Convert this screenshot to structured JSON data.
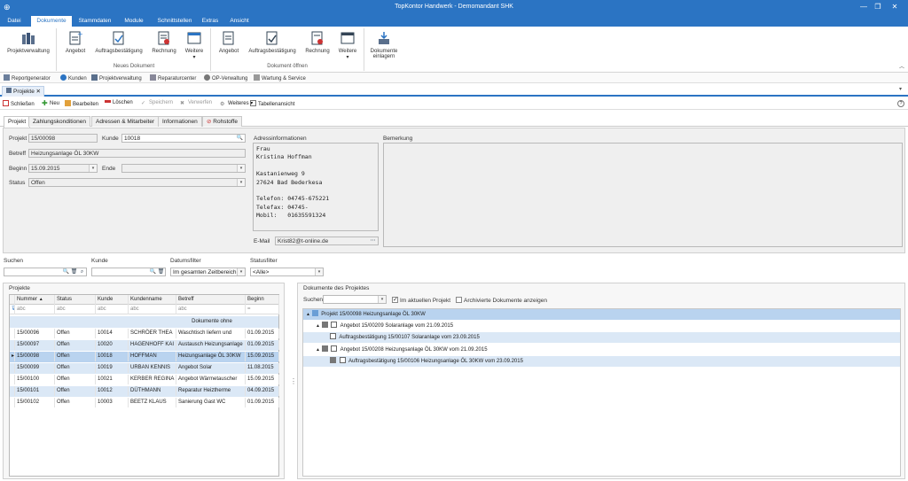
{
  "window": {
    "title": "TopKontor Handwerk - Demomandant SHK"
  },
  "menu_tabs": [
    "Datei",
    "Dokumente",
    "Stammdaten",
    "Module",
    "Schnittstellen",
    "Extras",
    "Ansicht"
  ],
  "ribbon": {
    "projektverwaltung": "Projektverwaltung",
    "neues": {
      "angebot": "Angebot",
      "auftrag": "Auftragsbestätigung",
      "rechnung": "Rechnung",
      "weitere": "Weitere",
      "group": "Neues Dokument"
    },
    "oeffnen": {
      "angebot": "Angebot",
      "auftrag": "Auftragsbestätigung",
      "rechnung": "Rechnung",
      "weitere": "Weitere",
      "group": "Dokument öffnen"
    },
    "einlagern_1": "Dokumente",
    "einlagern_2": "einlagern"
  },
  "quickbar": [
    "Reportgenerator",
    "Kunden",
    "Projektverwaltung",
    "Reparaturcenter",
    "OP-Verwaltung",
    "Wartung & Service"
  ],
  "doc_tab": "Projekte",
  "toolbar": {
    "schliessen": "Schließen",
    "neu": "Neu",
    "bearbeiten": "Bearbeiten",
    "loeschen": "Löschen",
    "speichern": "Speichern",
    "verwerfen": "Verwerfen",
    "weiteres": "Weiteres",
    "tabellenansicht": "Tabellenansicht"
  },
  "project_tabs": [
    "Projekt",
    "Zahlungskonditionen",
    "Adressen & Mitarbeiter",
    "Informationen",
    "Rohstoffe"
  ],
  "form": {
    "projekt_label": "Projekt",
    "projekt": "15/00098",
    "kunde_label": "Kunde",
    "kunde": "10018",
    "betreff_label": "Betreff",
    "betreff": "Heizungsanlage ÖL 30KW",
    "beginn_label": "Beginn",
    "beginn": "15.09.2015",
    "ende_label": "Ende",
    "ende": "",
    "status_label": "Status",
    "status": "Offen",
    "adress_label": "Adressinformationen",
    "adresse": "Frau\nKristina Hoffman\n\nKastanienweg 9\n27624 Bad Bederkesa\n\nTelefon: 04745-675221\nTelefax: 04745-\nMobil:   01635591324",
    "email_label": "E-Mail",
    "email": "Krist82@t-online.de",
    "bemerkung_label": "Bemerkung"
  },
  "filters": {
    "suchen_label": "Suchen",
    "suchen": "",
    "kunde_label": "Kunde",
    "kunde": "",
    "datum_label": "Datumsfilter",
    "datum": "Im gesamten Zeitbereich",
    "status_label": "Statusfilter",
    "status": "<Alle>"
  },
  "projects": {
    "title": "Projekte",
    "columns": [
      "Nummer",
      "Status",
      "Kunde",
      "Kundenname",
      "Betreff",
      "Beginn"
    ],
    "filter_row": [
      "abc",
      "abc",
      "abc",
      "abc",
      "abc",
      "="
    ],
    "group_label": "Dokumente ohne",
    "rows": [
      [
        "15/00096",
        "Offen",
        "10014",
        "SCHRÖER THEA",
        "Waschtisch liefern und",
        "01.09.2015"
      ],
      [
        "15/00097",
        "Offen",
        "10020",
        "HAGENHOFF KAI",
        "Austausch Heizungsanlage",
        "01.09.2015"
      ],
      [
        "15/00098",
        "Offen",
        "10018",
        "HOFFMAN",
        "Heizungsanlage ÖL 30KW",
        "15.09.2015"
      ],
      [
        "15/00099",
        "Offen",
        "10019",
        "URBAN KENNIS",
        "Angebot Solar",
        "11.08.2015"
      ],
      [
        "15/00100",
        "Offen",
        "10021",
        "KERBER REGINA",
        "Angebot Wärmetauscher",
        "15.09.2015"
      ],
      [
        "15/00101",
        "Offen",
        "10012",
        "DÜTHMANN",
        "Reparatur Heiztherme",
        "04.09.2015"
      ],
      [
        "15/00102",
        "Offen",
        "10003",
        "BEETZ KLAUS",
        "Sanierung Gast WC",
        "01.09.2015"
      ]
    ]
  },
  "documents": {
    "title": "Dokumente des Projektes",
    "suchen_label": "Suchen",
    "check_aktuell": "Im aktuellen Projekt",
    "check_archiv": "Archivierte Dokumente anzeigen",
    "tree": [
      "Projekt 15/00098 Heizungsanlage ÖL 30KW",
      "Angebot 15/00209 Solaranlage vom 21.09.2015",
      "Auftragsbestätigung 15/00107 Solaranlage vom 23.09.2015",
      "Angebot 15/00208 Heizungsanlage ÖL 30KW vom 21.09.2015",
      "Auftragsbestätigung 15/00106 Heizungsanlage ÖL 30KW vom 23.09.2015"
    ]
  },
  "colors": {
    "accent": "#2b74c3",
    "selected_row": "#b9d3ef",
    "alt_row": "#dbe8f6"
  }
}
